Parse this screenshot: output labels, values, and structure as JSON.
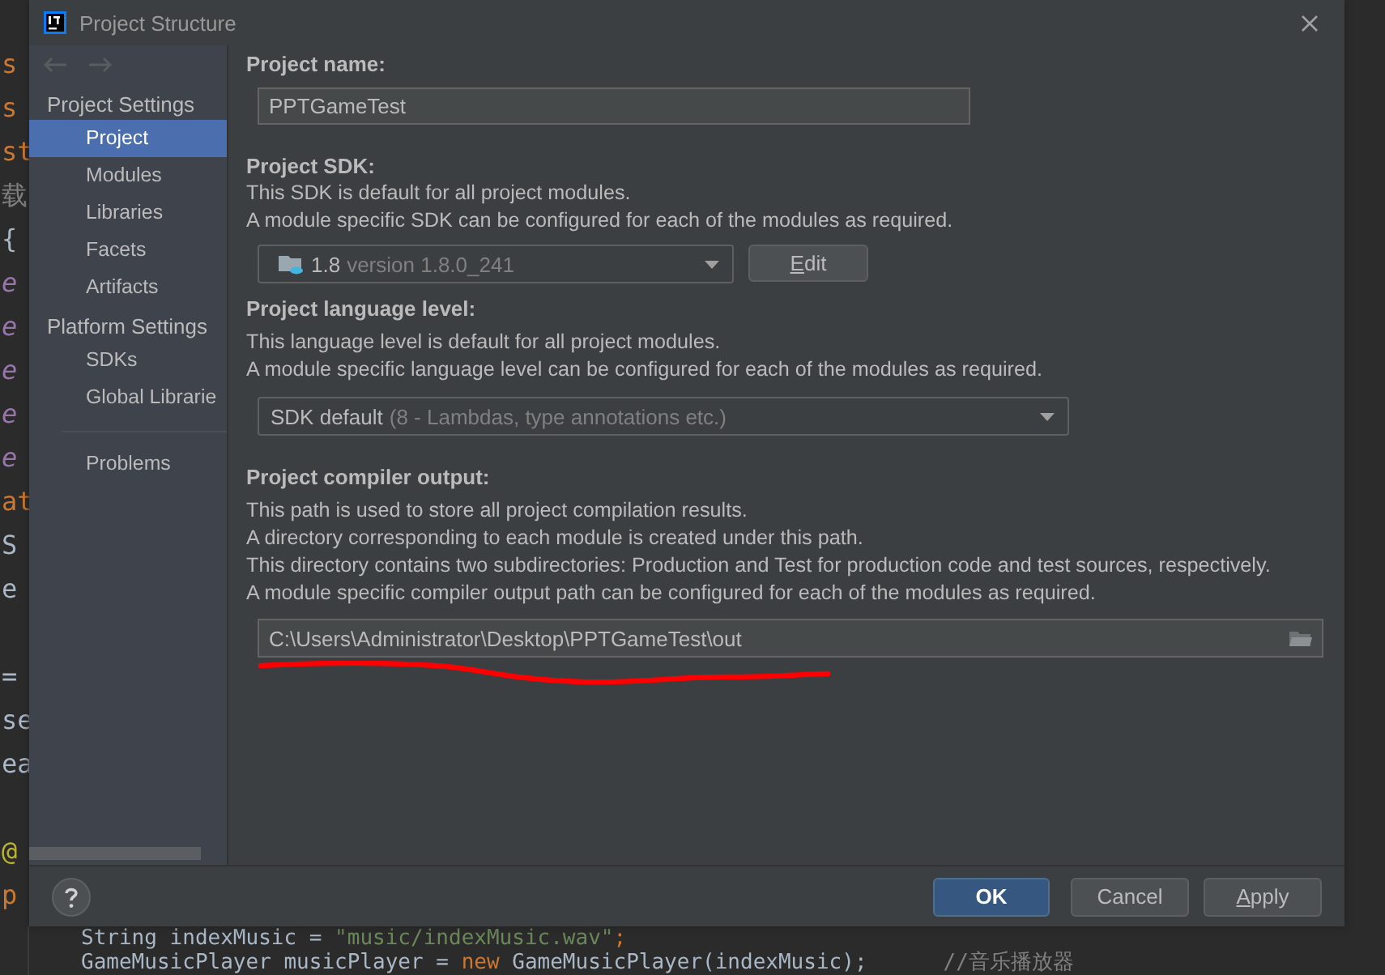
{
  "editor": {
    "left_blocks": [
      [
        {
          "text": "s",
          "kind": "keyword"
        },
        {
          "text": "s",
          "kind": "keyword"
        },
        {
          "text": "st",
          "kind": "keyword"
        },
        {
          "text": "载",
          "kind": "comment"
        },
        {
          "text": "{",
          "kind": "plain"
        },
        {
          "text": "e",
          "kind": "field"
        },
        {
          "text": "e",
          "kind": "field"
        },
        {
          "text": "e",
          "kind": "field"
        },
        {
          "text": "e",
          "kind": "field"
        },
        {
          "text": "e",
          "kind": "field"
        },
        {
          "text": "at",
          "kind": "keyword"
        },
        {
          "text": "S",
          "kind": "plain"
        },
        {
          "text": "e",
          "kind": "plain"
        }
      ],
      [
        {
          "text": "=",
          "kind": "plain"
        },
        {
          "text": "se",
          "kind": "plain"
        },
        {
          "text": "ea",
          "kind": "plain"
        }
      ],
      [
        {
          "text": "@",
          "kind": "annotation"
        },
        {
          "text": "p",
          "kind": "keyword"
        }
      ]
    ],
    "bottom_lines": [
      [
        {
          "text": "String indexMusic = ",
          "kind": "plain"
        },
        {
          "text": "\"music/indexMusic.wav\"",
          "kind": "string"
        },
        {
          "text": ";",
          "kind": "keyword"
        }
      ],
      [
        {
          "text": "GameMusicPlayer musicPlayer = ",
          "kind": "plain"
        },
        {
          "text": "new ",
          "kind": "keyword"
        },
        {
          "text": "GameMusicPlayer(indexMusic);",
          "kind": "plain"
        },
        {
          "text": "      //音乐播放器",
          "kind": "comment"
        }
      ]
    ]
  },
  "window": {
    "title": "Project Structure"
  },
  "nav": {
    "back_disabled": true,
    "forward_disabled": true
  },
  "sidebar": {
    "sections": [
      {
        "title": "Project Settings",
        "items": [
          {
            "label": "Project",
            "selected": true
          },
          {
            "label": "Modules",
            "selected": false
          },
          {
            "label": "Libraries",
            "selected": false
          },
          {
            "label": "Facets",
            "selected": false
          },
          {
            "label": "Artifacts",
            "selected": false
          }
        ]
      },
      {
        "title": "Platform Settings",
        "items": [
          {
            "label": "SDKs",
            "selected": false
          },
          {
            "label": "Global Librarie",
            "selected": false
          }
        ]
      }
    ],
    "extra_items": [
      {
        "label": "Problems",
        "selected": false
      }
    ]
  },
  "project_name": {
    "label": "Project name:",
    "value": "PPTGameTest"
  },
  "project_sdk": {
    "label": "Project SDK:",
    "description": [
      "This SDK is default for all project modules.",
      "A module specific SDK can be configured for each of the modules as required."
    ],
    "value": "1.8",
    "detail": "version 1.8.0_241",
    "edit_button": {
      "label": "Edit",
      "mnemonic_underlined": true
    }
  },
  "language_level": {
    "label": "Project language level:",
    "description": [
      "This language level is default for all project modules.",
      "A module specific language level can be configured for each of the modules as required."
    ],
    "value": "SDK default",
    "detail": "(8 - Lambdas, type annotations etc.)"
  },
  "compiler_output": {
    "label": "Project compiler output:",
    "description": [
      "This path is used to store all project compilation results.",
      "A directory corresponding to each module is created under this path.",
      "This directory contains two subdirectories: Production and Test for production code and test sources, respectively.",
      "A module specific compiler output path can be configured for each of the modules as required."
    ],
    "value": "C:\\Users\\Administrator\\Desktop\\PPTGameTest\\out"
  },
  "buttons": [
    {
      "label": "OK",
      "kind": "primary"
    },
    {
      "label": "Cancel",
      "kind": "normal"
    },
    {
      "label": "Apply",
      "kind": "normal",
      "mnemonic_underlined": true
    }
  ]
}
